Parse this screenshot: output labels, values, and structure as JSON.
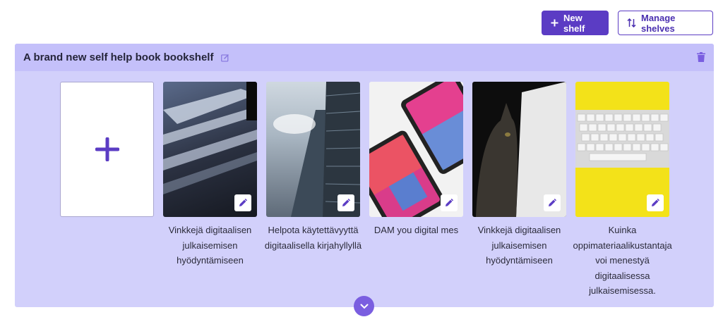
{
  "toolbar": {
    "new_shelf_label": "New shelf",
    "manage_shelves_label": "Manage shelves"
  },
  "shelf": {
    "title": "A brand new self help book bookshelf",
    "books": [
      {
        "title": "Vinkkejä digitaalisen julkaisemisen hyödyntämiseen"
      },
      {
        "title": "Helpota käytettävyyttä digitaalisella kirjahyllyllä"
      },
      {
        "title": "DAM you digital mes"
      },
      {
        "title": "Vinkkejä digitaalisen julkaisemisen hyödyntämiseen"
      },
      {
        "title": "Kuinka oppimateriaalikustantaja voi menestyä digitaalisessa julkaisemisessa."
      }
    ]
  },
  "colors": {
    "accent": "#5b3cc4",
    "shelf_bg": "#d2d0fb",
    "shelf_header_bg": "#c4c0fa"
  },
  "icons": {
    "new_shelf": "plus-icon",
    "manage": "sort-arrows-icon",
    "edit": "pencil-icon",
    "delete": "trash-icon",
    "expand": "chevron-down-icon"
  }
}
